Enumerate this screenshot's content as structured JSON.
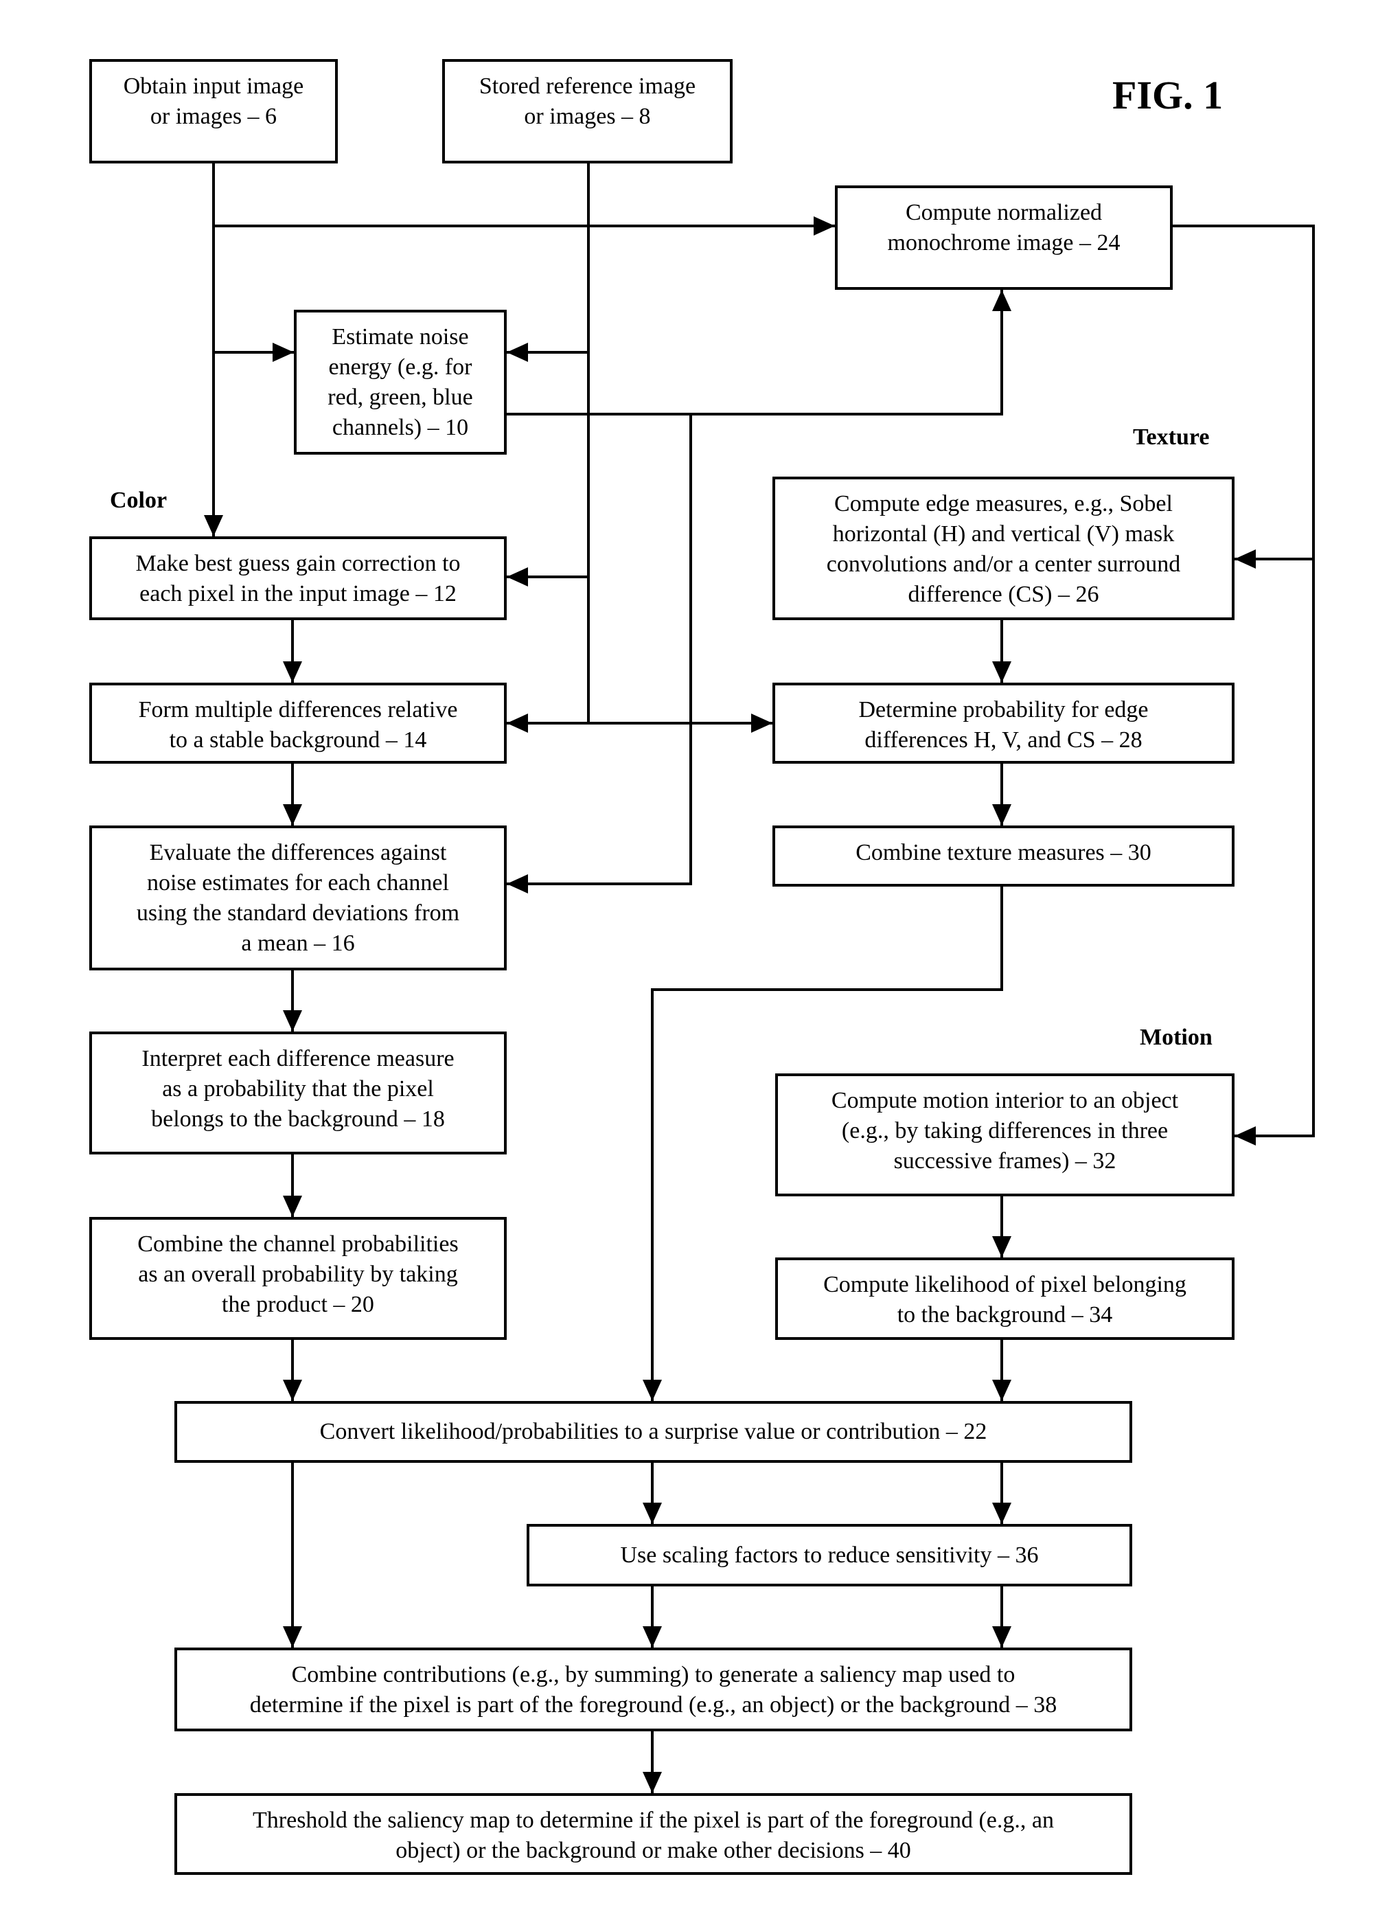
{
  "figure": {
    "title": "FIG. 1"
  },
  "section_labels": {
    "color": "Color",
    "texture": "Texture",
    "motion": "Motion"
  },
  "steps": {
    "s6": {
      "id": 6,
      "text": "Obtain input image\nor images – 6"
    },
    "s8": {
      "id": 8,
      "text": "Stored reference image\nor images – 8"
    },
    "s10": {
      "id": 10,
      "text": "Estimate noise\nenergy (e.g. for\nred, green, blue\nchannels) – 10"
    },
    "s12": {
      "id": 12,
      "text": "Make best guess gain correction to\neach pixel in the input image – 12"
    },
    "s14": {
      "id": 14,
      "text": "Form multiple differences relative\nto a stable background – 14"
    },
    "s16": {
      "id": 16,
      "text": "Evaluate the differences against\nnoise estimates for each channel\nusing the standard deviations from\na mean – 16"
    },
    "s18": {
      "id": 18,
      "text": "Interpret each difference measure\nas a probability that the pixel\nbelongs to the background – 18"
    },
    "s20": {
      "id": 20,
      "text": "Combine the channel probabilities\nas an overall probability by taking\nthe product – 20"
    },
    "s22": {
      "id": 22,
      "text": "Convert likelihood/probabilities to a surprise value or contribution – 22"
    },
    "s24": {
      "id": 24,
      "text": "Compute normalized\nmonochrome image – 24"
    },
    "s26": {
      "id": 26,
      "text": "Compute edge measures, e.g., Sobel\nhorizontal (H) and vertical (V) mask\nconvolutions and/or a center surround\ndifference (CS) – 26"
    },
    "s28": {
      "id": 28,
      "text": "Determine probability for edge\ndifferences H, V, and CS – 28"
    },
    "s30": {
      "id": 30,
      "text": "Combine texture measures – 30"
    },
    "s32": {
      "id": 32,
      "text": "Compute motion interior to an object\n(e.g., by taking differences in three\nsuccessive frames) – 32"
    },
    "s34": {
      "id": 34,
      "text": "Compute likelihood of pixel belonging\nto the background – 34"
    },
    "s36": {
      "id": 36,
      "text": "Use scaling factors to reduce sensitivity – 36"
    },
    "s38": {
      "id": 38,
      "text": "Combine contributions (e.g., by summing) to generate a saliency map used to\ndetermine if the pixel is part of the foreground (e.g., an object) or the background – 38"
    },
    "s40": {
      "id": 40,
      "text": "Threshold the saliency map to determine if the pixel is part of the foreground (e.g., an\nobject) or the background or make other decisions – 40"
    }
  },
  "connections": [
    {
      "from": 6,
      "to": 24
    },
    {
      "from": 6,
      "to": 10
    },
    {
      "from": 6,
      "to": 12
    },
    {
      "from": 8,
      "to": 10
    },
    {
      "from": 8,
      "to": 12
    },
    {
      "from": 8,
      "to": 14
    },
    {
      "from": 8,
      "to": 28
    },
    {
      "from": 10,
      "to": 24
    },
    {
      "from": 10,
      "to": 16
    },
    {
      "from": 12,
      "to": 14
    },
    {
      "from": 14,
      "to": 16
    },
    {
      "from": 16,
      "to": 18
    },
    {
      "from": 18,
      "to": 20
    },
    {
      "from": 20,
      "to": 22
    },
    {
      "from": 24,
      "to": 26
    },
    {
      "from": 24,
      "to": 32
    },
    {
      "from": 26,
      "to": 28
    },
    {
      "from": 28,
      "to": 30
    },
    {
      "from": 30,
      "to": 22
    },
    {
      "from": 32,
      "to": 34
    },
    {
      "from": 34,
      "to": 22
    },
    {
      "from": 22,
      "to": 36
    },
    {
      "from": 22,
      "to": 38
    },
    {
      "from": 36,
      "to": 38
    },
    {
      "from": 38,
      "to": 40
    }
  ]
}
